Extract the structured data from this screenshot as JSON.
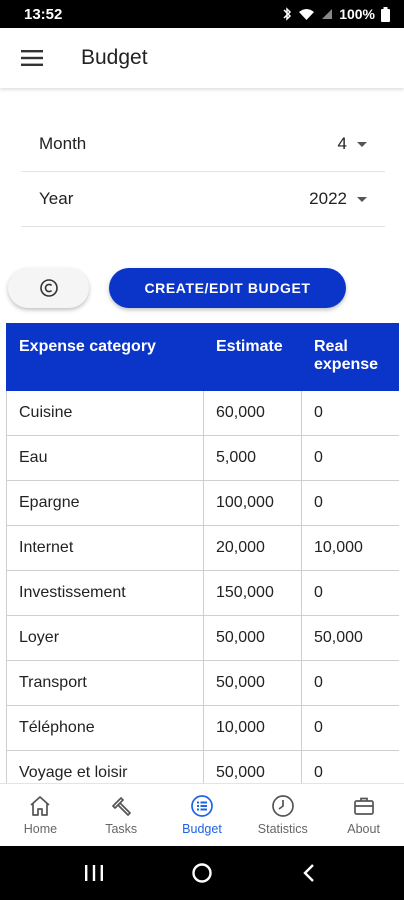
{
  "status": {
    "time": "13:52",
    "battery": "100%"
  },
  "app_bar": {
    "title": "Budget"
  },
  "filters": {
    "month": {
      "label": "Month",
      "value": "4"
    },
    "year": {
      "label": "Year",
      "value": "2022"
    }
  },
  "actions": {
    "create_label": "CREATE/EDIT BUDGET"
  },
  "table": {
    "headers": [
      "Expense category",
      "Estimate",
      "Real expense"
    ],
    "rows": [
      [
        "Cuisine",
        "60,000",
        "0"
      ],
      [
        "Eau",
        "5,000",
        "0"
      ],
      [
        "Epargne",
        "100,000",
        "0"
      ],
      [
        "Internet",
        "20,000",
        "10,000"
      ],
      [
        "Investissement",
        "150,000",
        "0"
      ],
      [
        "Loyer",
        "50,000",
        "50,000"
      ],
      [
        "Transport",
        "50,000",
        "0"
      ],
      [
        "Téléphone",
        "10,000",
        "0"
      ],
      [
        "Voyage et loisir",
        "50,000",
        "0"
      ]
    ]
  },
  "bottom_nav": {
    "items": [
      {
        "label": "Home",
        "icon": "home-icon"
      },
      {
        "label": "Tasks",
        "icon": "hammer-icon"
      },
      {
        "label": "Budget",
        "icon": "list-icon",
        "active": true
      },
      {
        "label": "Statistics",
        "icon": "clock-icon"
      },
      {
        "label": "About",
        "icon": "briefcase-icon"
      }
    ]
  },
  "colors": {
    "primary": "#0a35c8",
    "nav_active": "#1e63e6"
  }
}
